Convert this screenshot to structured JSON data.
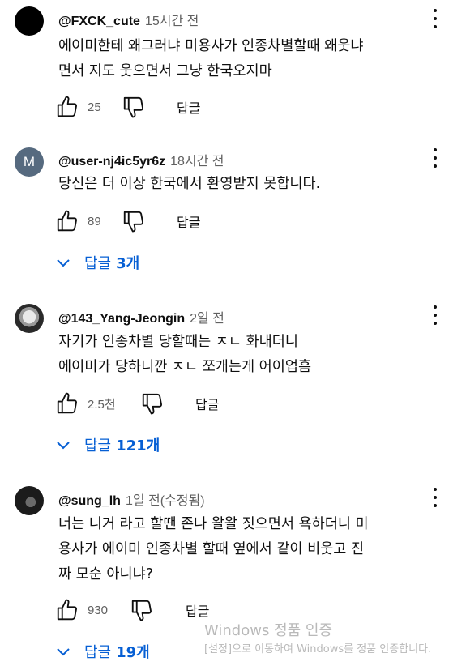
{
  "comments": [
    {
      "handle": "@FXCK_cute",
      "time": "15시간 전",
      "text": "에이미한테 왜그러냐 미용사가 인종차별할때 왜웃냐\n면서 지도 웃으면서 그냥 한국오지마",
      "likes": "25",
      "reply_label": "답글",
      "avatar_icon": "avatar-black-circle"
    },
    {
      "handle": "@user-nj4ic5yr6z",
      "time": "18시간 전",
      "text": "당신은 더 이상 한국에서 환영받지 못합니다.",
      "likes": "89",
      "reply_label": "답글",
      "avatar_letter": "M",
      "replies_label": "답글",
      "replies_count": "3개"
    },
    {
      "handle": "@143_Yang-Jeongin",
      "time": "2일 전",
      "text": "자기가 인종차별 당할때는 ㅈㄴ 화내더니\n에이미가 당하니깐 ㅈㄴ 쪼개는게 어이업흠",
      "likes": "2.5천",
      "reply_label": "답글",
      "replies_label": "답글",
      "replies_count": "121개"
    },
    {
      "handle": "@sung_lh",
      "time": "1일 전(수정됨)",
      "text": "너는 니거 라고 할땐 존나 왈왈 짓으면서 욕하더니 미\n용사가 에이미 인종차별 할때 옆에서 같이 비웃고 진\n짜 모순 아니냐?",
      "likes": "930",
      "reply_label": "답글",
      "replies_label": "답글",
      "replies_count": "19개"
    }
  ],
  "watermark": {
    "title": "Windows 정품 인증",
    "subtitle": "[설정]으로 이동하여 Windows를 정품 인증합니다."
  },
  "colors": {
    "link": "#065fd4",
    "meta": "#606060",
    "text": "#0f0f0f"
  }
}
